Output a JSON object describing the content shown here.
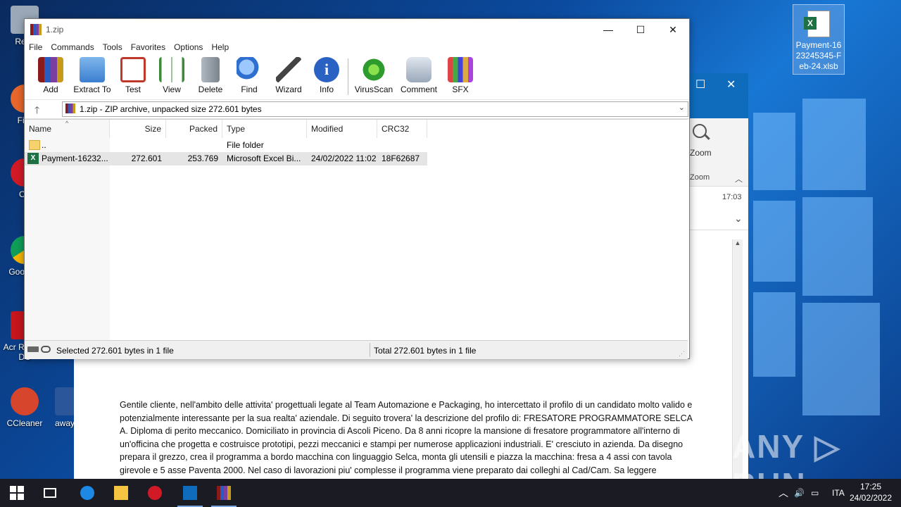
{
  "desktop": {
    "icons": [
      {
        "label": "Recy"
      },
      {
        "label": "Fire"
      },
      {
        "label": "Op"
      },
      {
        "label": "Goo Chr"
      },
      {
        "label": "Acr Reader DC"
      },
      {
        "label": "CCleaner"
      },
      {
        "label": "away"
      }
    ],
    "file_icon": {
      "label": "Payment-1623245345-Feb-24.xlsb",
      "badge": "X"
    }
  },
  "outlook": {
    "zoom_label": "Zoom",
    "zoom_group": "Zoom",
    "time": "17:03",
    "body_text": "Gentile cliente, nell'ambito delle attivita' progettuali legate al Team Automazione e Packaging, ho intercettato il profilo di un candidato molto valido e potenzialmente interessante per la sua realta' aziendale. Di seguito trovera' la descrizione del profilo di: FRESATORE PROGRAMMATORE SELCA A. Diploma di perito meccanico. Domiciliato in provincia di Ascoli Piceno. Da 8 anni ricopre la mansione di fresatore programmatore all'interno di un'officina che progetta e costruisce prototipi, pezzi meccanici e stampi per numerose applicazioni industriali. E' cresciuto in azienda. Da disegno prepara il grezzo, crea il programma a bordo macchina con linguaggio Selca, monta gli utensili e piazza la macchina: fresa a 4 assi con tavola girevole e 5 asse Paventa 2000. Nel caso di lavorazioni piu' complesse il programma viene preparato dai colleghi al Cad/Cam. Sa leggere autonomamente il disegno meccanico. Lavora su materiali"
  },
  "winrar": {
    "title": "1.zip",
    "window_controls": {
      "minimize": "—",
      "maximize": "☐",
      "close": "✕"
    },
    "menu": [
      "File",
      "Commands",
      "Tools",
      "Favorites",
      "Options",
      "Help"
    ],
    "toolbar": [
      {
        "label": "Add",
        "icon": "add-icon",
        "color": "#b8342a"
      },
      {
        "label": "Extract To",
        "icon": "extract-to-icon",
        "color": "#4a8fd8"
      },
      {
        "label": "Test",
        "icon": "test-icon",
        "color": "#c0392b"
      },
      {
        "label": "View",
        "icon": "view-icon",
        "color": "#3a8a3a"
      },
      {
        "label": "Delete",
        "icon": "delete-icon",
        "color": "#8a949c"
      },
      {
        "label": "Find",
        "icon": "find-icon",
        "color": "#2e6fcf"
      },
      {
        "label": "Wizard",
        "icon": "wizard-icon",
        "color": "#6a7fa8"
      },
      {
        "label": "Info",
        "icon": "info-icon",
        "color": "#2a62c4"
      },
      {
        "label": "VirusScan",
        "icon": "virusscan-icon",
        "color": "#2d9b2d"
      },
      {
        "label": "Comment",
        "icon": "comment-icon",
        "color": "#7f8fa6"
      },
      {
        "label": "SFX",
        "icon": "sfx-icon",
        "color": "#d47a2a"
      }
    ],
    "address": "1.zip - ZIP archive, unpacked size 272.601 bytes",
    "columns": [
      "Name",
      "Size",
      "Packed",
      "Type",
      "Modified",
      "CRC32"
    ],
    "rows": [
      {
        "name": "..",
        "size": "",
        "packed": "",
        "type": "File folder",
        "modified": "",
        "crc": ""
      },
      {
        "name": "Payment-16232...",
        "size": "272.601",
        "packed": "253.769",
        "type": "Microsoft Excel Bi...",
        "modified": "24/02/2022 11:02",
        "crc": "18F62687"
      }
    ],
    "status_left": "Selected 272.601 bytes in 1 file",
    "status_right": "Total 272.601 bytes in 1 file"
  },
  "taskbar": {
    "language": "ITA",
    "time": "17:25",
    "date": "24/02/2022"
  },
  "watermark": "ANY ▷ RUN"
}
